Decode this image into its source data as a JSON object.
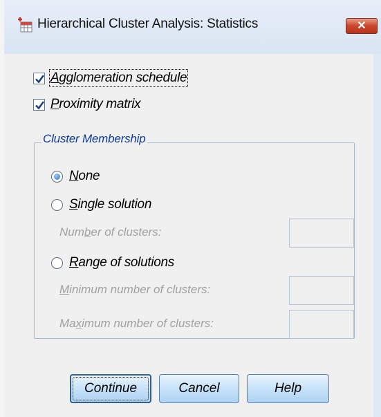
{
  "window": {
    "title": "Hierarchical Cluster Analysis: Statistics",
    "app_icon": "spss-dialog-icon",
    "close_icon": "close-icon",
    "close_glyph": "✕"
  },
  "options": {
    "agglomeration": {
      "prefix": "",
      "mnemonic": "A",
      "suffix": "gglomeration schedule",
      "checked": true
    },
    "proximity": {
      "prefix": "",
      "mnemonic": "P",
      "suffix": "roximity matrix",
      "checked": true
    }
  },
  "cluster_membership": {
    "title": "Cluster Membership",
    "none": {
      "mnemonic": "N",
      "suffix": "one",
      "selected": true
    },
    "single": {
      "mnemonic": "S",
      "suffix": "ingle solution",
      "selected": false
    },
    "number_of_clusters": {
      "prefix": "Num",
      "mnemonic": "b",
      "suffix": "er of clusters:",
      "value": ""
    },
    "range": {
      "mnemonic": "R",
      "suffix": "ange of solutions",
      "selected": false
    },
    "min_clusters": {
      "prefix": "",
      "mnemonic": "M",
      "suffix": "inimum number of clusters:",
      "value": ""
    },
    "max_clusters": {
      "prefix": "Ma",
      "mnemonic": "x",
      "suffix": "imum number of clusters:",
      "value": ""
    }
  },
  "buttons": {
    "continue": "Continue",
    "cancel": "Cancel",
    "help": "Help"
  },
  "colors": {
    "group_title": "#0a3a9a",
    "disabled_text": "#a0a0a0",
    "button_gradient_top": "#eaf4fd",
    "button_gradient_bottom": "#aed3f2"
  }
}
